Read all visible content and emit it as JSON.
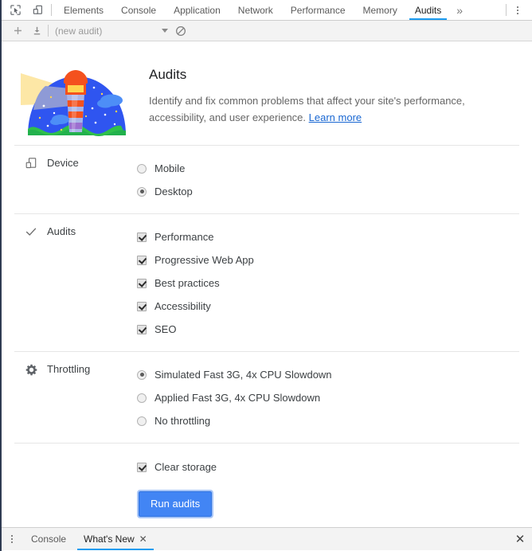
{
  "window": {
    "accent_blue": "#1a9bf0",
    "button_blue": "#4285f4",
    "link_blue": "#1967d2"
  },
  "toolbar": {
    "inspect_icon": "inspect-cursor-icon",
    "device_toggle_icon": "device-toolbar-icon",
    "tabs": [
      {
        "label": "Elements",
        "active": false
      },
      {
        "label": "Console",
        "active": false
      },
      {
        "label": "Application",
        "active": false
      },
      {
        "label": "Network",
        "active": false
      },
      {
        "label": "Performance",
        "active": false
      },
      {
        "label": "Memory",
        "active": false
      },
      {
        "label": "Audits",
        "active": true
      }
    ],
    "more_tabs_label": "»",
    "main_menu_icon": "kebab-menu-icon"
  },
  "audit_toolbar": {
    "add_label": "+",
    "add_icon": "plus-icon",
    "import_icon": "download-icon",
    "select_value": "(new audit)",
    "clear_icon": "no-entry-clear-icon"
  },
  "hero": {
    "logo_icon": "lighthouse-logo",
    "title": "Audits",
    "description": "Identify and fix common problems that affect your site's performance, accessibility, and user experience.",
    "link_label": "Learn more"
  },
  "sections": [
    {
      "id": "device",
      "label": "Device",
      "icon": "device-icon",
      "control": "radio",
      "options": [
        {
          "label": "Mobile",
          "checked": false
        },
        {
          "label": "Desktop",
          "checked": true
        }
      ]
    },
    {
      "id": "audits",
      "label": "Audits",
      "icon": "checkmark-icon",
      "control": "checkbox",
      "options": [
        {
          "label": "Performance",
          "checked": true
        },
        {
          "label": "Progressive Web App",
          "checked": true
        },
        {
          "label": "Best practices",
          "checked": true
        },
        {
          "label": "Accessibility",
          "checked": true
        },
        {
          "label": "SEO",
          "checked": true
        }
      ]
    },
    {
      "id": "throttling",
      "label": "Throttling",
      "icon": "gear-icon",
      "control": "radio",
      "options": [
        {
          "label": "Simulated Fast 3G, 4x CPU Slowdown",
          "checked": true
        },
        {
          "label": "Applied Fast 3G, 4x CPU Slowdown",
          "checked": false
        },
        {
          "label": "No throttling",
          "checked": false
        }
      ]
    }
  ],
  "footer_controls": {
    "clear_storage": {
      "label": "Clear storage",
      "checked": true
    },
    "run_button_label": "Run audits"
  },
  "drawer": {
    "menu_icon": "kebab-menu-icon",
    "tabs": [
      {
        "label": "Console",
        "active": false,
        "closable": false
      },
      {
        "label": "What's New",
        "active": true,
        "closable": true,
        "close_label": "✕"
      }
    ],
    "close_label": "✕"
  }
}
